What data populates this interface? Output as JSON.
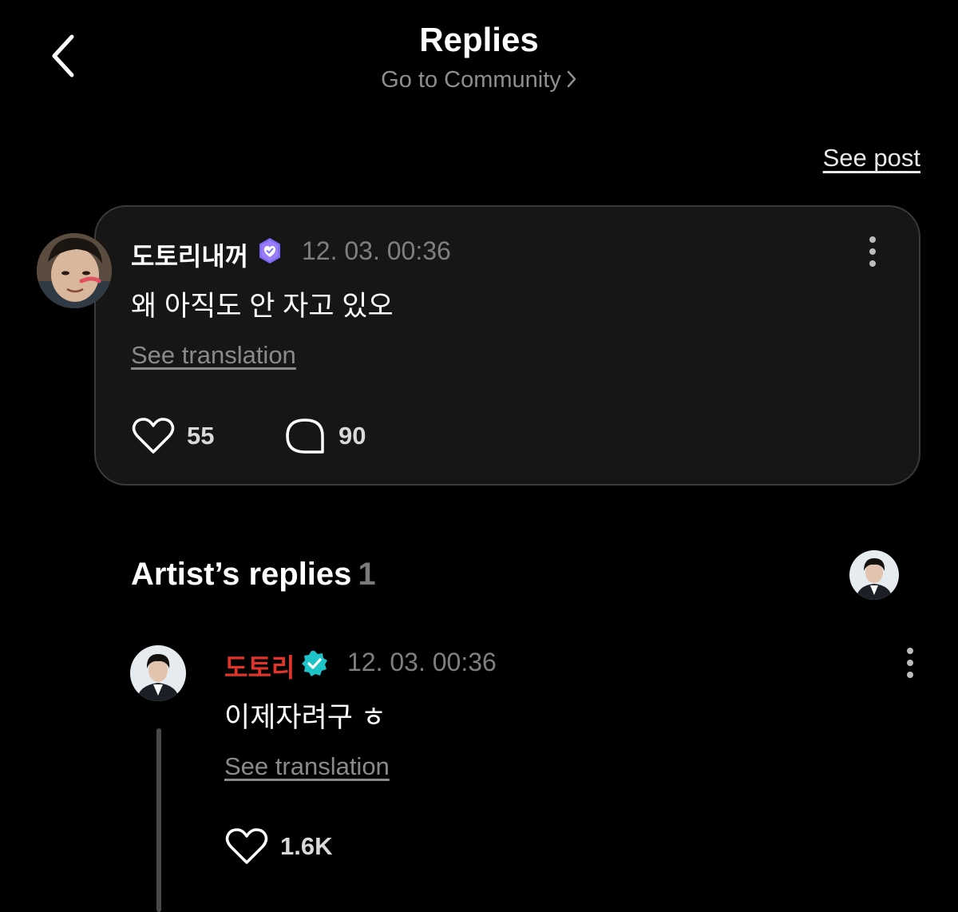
{
  "header": {
    "title": "Replies",
    "community_link": "Go to Community"
  },
  "see_post_label": "See post",
  "post": {
    "username": "도토리내꺼",
    "timestamp": "12. 03. 00:36",
    "text": "왜 아직도 안 자고 있오",
    "see_translation": "See translation",
    "likes": "55",
    "comments": "90",
    "badge_color": "#7b6cf6"
  },
  "artist_replies": {
    "title": "Artist’s replies",
    "count": "1"
  },
  "reply": {
    "username": "도토리",
    "username_color": "#e2332a",
    "timestamp": "12. 03. 00:36",
    "text": "이제자려구 ㅎ",
    "see_translation": "See translation",
    "likes": "1.6K",
    "badge_color": "#1ec3c7"
  }
}
